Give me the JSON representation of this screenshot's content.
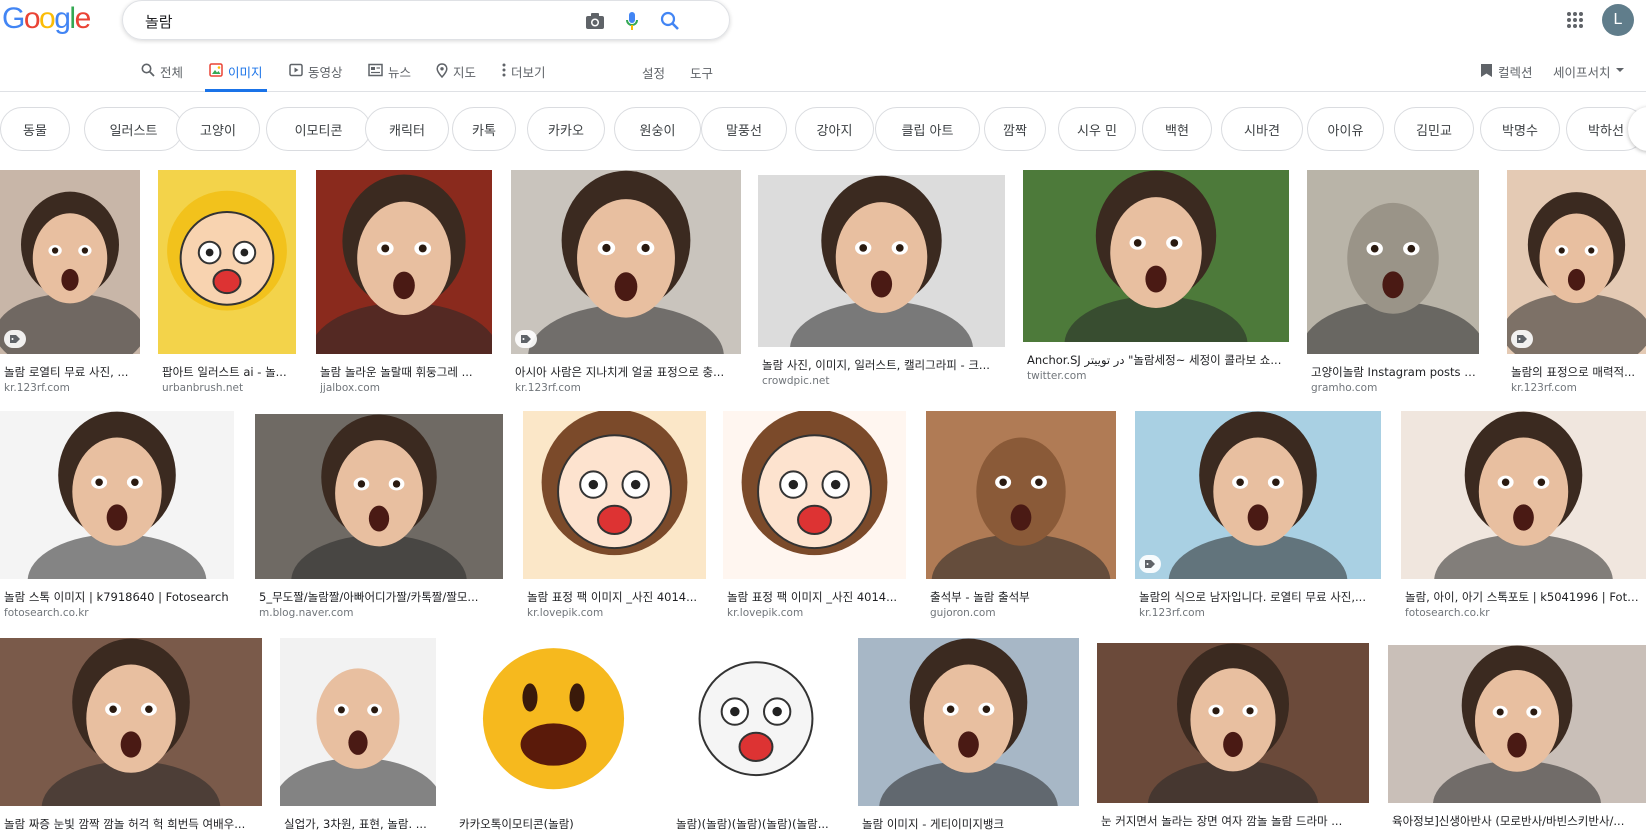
{
  "header": {
    "logo": "Google",
    "query": "놀람",
    "avatar_letter": "L"
  },
  "tabs": [
    {
      "label": "전체",
      "active": false
    },
    {
      "label": "이미지",
      "active": true
    },
    {
      "label": "동영상",
      "active": false
    },
    {
      "label": "뉴스",
      "active": false
    },
    {
      "label": "지도",
      "active": false
    },
    {
      "label": "더보기",
      "active": false
    }
  ],
  "tools": {
    "settings": "설정",
    "tools": "도구",
    "collections": "컬렉션",
    "safesearch": "세이프서치"
  },
  "chips": [
    "동물",
    "일러스트",
    "고양이",
    "이모티콘",
    "캐릭터",
    "카톡",
    "카카오",
    "원숭이",
    "말풍선",
    "강아지",
    "클립 아트",
    "깜짝",
    "시우 민",
    "백현",
    "시바견",
    "아이유",
    "김민교",
    "박명수",
    "박하선"
  ],
  "results": [
    {
      "caption": "놀람 로열티 무료 사진, ...",
      "source": "kr.123rf.com"
    },
    {
      "caption": "팝아트 일러스트 ai - 놀...",
      "source": "urbanbrush.net"
    },
    {
      "caption": "놀람 놀라운 놀랄때 휘둥그레 ...",
      "source": "jjalbox.com"
    },
    {
      "caption": "아시아 사람은 지나치게 얼굴 표정으로 충...",
      "source": "kr.123rf.com"
    },
    {
      "caption": "놀람 사진, 이미지, 일러스트, 캘리그라피 - 크...",
      "source": "crowdpic.net"
    },
    {
      "caption": "Anchor.SJ در توییتر \"놀람세정~ 세정이 콜라보 쇼...",
      "source": "twitter.com"
    },
    {
      "caption": "고양이놀람 Instagram posts - G...",
      "source": "gramho.com"
    },
    {
      "caption": "놀람의 표정으로 매력적...",
      "source": "kr.123rf.com"
    },
    {
      "caption": "놀람 스톡 이미지 | k7918640 | Fotosearch",
      "source": "fotosearch.co.kr"
    },
    {
      "caption": "5_무도짤/놀람짤/아빠어디가짤/카톡짤/짤모...",
      "source": "m.blog.naver.com"
    },
    {
      "caption": "놀람 표정 팩 이미지 _사진 4014...",
      "source": "kr.lovepik.com"
    },
    {
      "caption": "놀람 표정 팩 이미지 _사진 4014...",
      "source": "kr.lovepik.com"
    },
    {
      "caption": "출석부 - 놀람 출석부",
      "source": "gujoron.com"
    },
    {
      "caption": "놀람의 식으로 남자입니다. 로열티 무료 사진,...",
      "source": "kr.123rf.com"
    },
    {
      "caption": "놀람, 아이, 아기 스톡포토 | k5041996 | Foto...",
      "source": "fotosearch.co.kr"
    },
    {
      "caption": "놀람 짜증 눈빛 깜짝 깜놀 허걱 헉 희번득 여배우...",
      "source": ""
    },
    {
      "caption": "실업가, 3차원, 표현, 놀람. ...",
      "source": ""
    },
    {
      "caption": "카카오톡이모티콘(놀람)",
      "source": ""
    },
    {
      "caption": "놀람)(놀람)(놀람)(놀람)(놀람...",
      "source": ""
    },
    {
      "caption": "놀람 이미지 - 게티이미지뱅크",
      "source": ""
    },
    {
      "caption": "눈 커지면서 놀라는 장면 여자 깜놀 놀람 드라마 ...",
      "source": ""
    },
    {
      "caption": "육아정보]신생아반사 (모로반사/바빈스키반사/...",
      "source": ""
    }
  ],
  "colors": {
    "blue": "#4285F4",
    "red": "#EA4335",
    "yellow": "#FBBC05",
    "green": "#34A853",
    "accent": "#1a73e8"
  }
}
